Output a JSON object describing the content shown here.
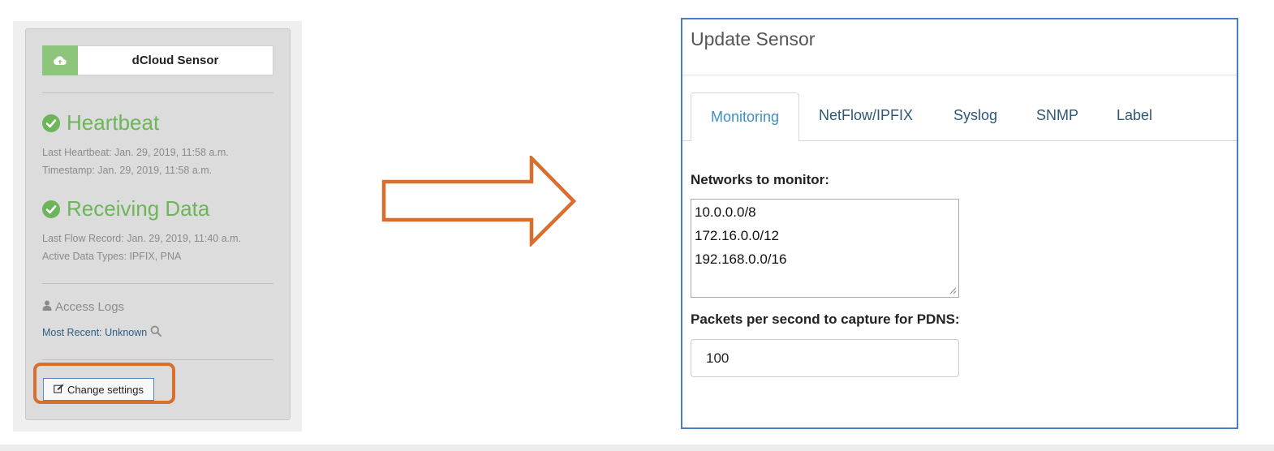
{
  "sensor_panel": {
    "cloud_icon": "cloud-upload-icon",
    "sensor_name": "dCloud Sensor",
    "heartbeat": {
      "title": "Heartbeat",
      "last_heartbeat": "Last Heartbeat: Jan. 29, 2019, 11:58 a.m.",
      "timestamp": "Timestamp: Jan. 29, 2019, 11:58 a.m."
    },
    "receiving": {
      "title": "Receiving Data",
      "last_flow": "Last Flow Record: Jan. 29, 2019, 11:40 a.m.",
      "data_types": "Active Data Types: IPFIX, PNA"
    },
    "access_logs": {
      "title": "Access Logs",
      "recent": "Most Recent: Unknown"
    },
    "change_settings_label": "Change settings",
    "status_color": "#6cb55b",
    "highlight_color": "#d76f2f"
  },
  "dialog": {
    "title": "Update Sensor",
    "tabs": [
      {
        "label": "Monitoring",
        "active": true
      },
      {
        "label": "NetFlow/IPFIX",
        "active": false
      },
      {
        "label": "Syslog",
        "active": false
      },
      {
        "label": "SNMP",
        "active": false
      },
      {
        "label": "Label",
        "active": false
      }
    ],
    "networks_label": "Networks to monitor:",
    "networks": [
      "10.0.0.0/8",
      "172.16.0.0/12",
      "192.168.0.0/16"
    ],
    "pdns_label": "Packets per second to capture for PDNS:",
    "pdns_value": "100",
    "border_color": "#4a7cc7",
    "active_tab_color": "#3f8fc3"
  }
}
